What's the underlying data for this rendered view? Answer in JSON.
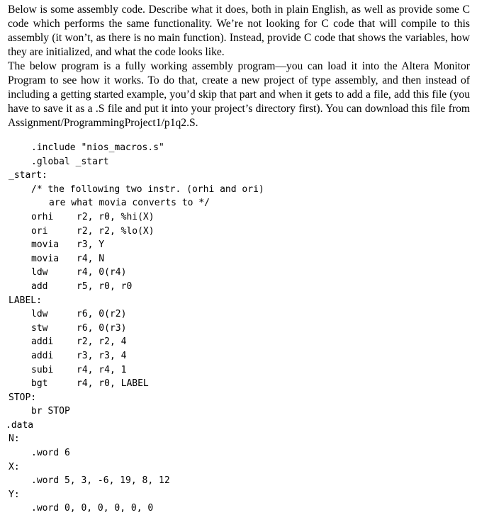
{
  "prose": {
    "paragraph_1": "Below is some assembly code. Describe what it does, both in plain English, as well as provide some C code which performs the same functionality. We’re not looking for C code that will compile to this assembly (it won’t, as there is no main function). Instead, provide C code that shows the variables, how they are initialized, and what the code looks like.",
    "paragraph_2": "The below program is a fully working assembly program—you can load it into the Altera Monitor Program to see how it works. To do that, create a new project of type assembly, and then instead of including a getting started example, you’d skip that part and when it gets to add a file, add this file (you have to save it as a .S file and put it into your project’s directory first). You can download this file from Assignment/ProgrammingProject1/p1q2.S."
  },
  "code": {
    "include": ".include \"nios_macros.s\"",
    "global": ".global _start",
    "start_label": "_start:",
    "comment_1": "/* the following two instr. (orhi and ori)",
    "comment_2": "are what movia converts to */",
    "instructions_1": [
      {
        "op": "orhi",
        "args": "r2, r0, %hi(X)"
      },
      {
        "op": "ori",
        "args": "r2, r2, %lo(X)"
      },
      {
        "op": "movia",
        "args": "r3, Y"
      },
      {
        "op": "movia",
        "args": "r4, N"
      },
      {
        "op": "ldw",
        "args": "r4, 0(r4)"
      },
      {
        "op": "add",
        "args": "r5, r0, r0"
      }
    ],
    "loop_label": "LABEL:",
    "instructions_2": [
      {
        "op": "ldw",
        "args": "r6, 0(r2)"
      },
      {
        "op": "stw",
        "args": "r6, 0(r3)"
      },
      {
        "op": "addi",
        "args": "r2, r2, 4"
      },
      {
        "op": "addi",
        "args": "r3, r3, 4"
      },
      {
        "op": "subi",
        "args": "r4, r4, 1"
      },
      {
        "op": "bgt",
        "args": "r4, r0, LABEL"
      }
    ],
    "stop_label": "STOP:",
    "stop_instr": "br STOP",
    "data_directive": ".data",
    "n_label": "N:",
    "n_word": ".word 6",
    "x_label": "X:",
    "x_word": ".word 5, 3, -6, 19, 8, 12",
    "y_label": "Y:",
    "y_word": ".word 0, 0, 0, 0, 0, 0"
  }
}
